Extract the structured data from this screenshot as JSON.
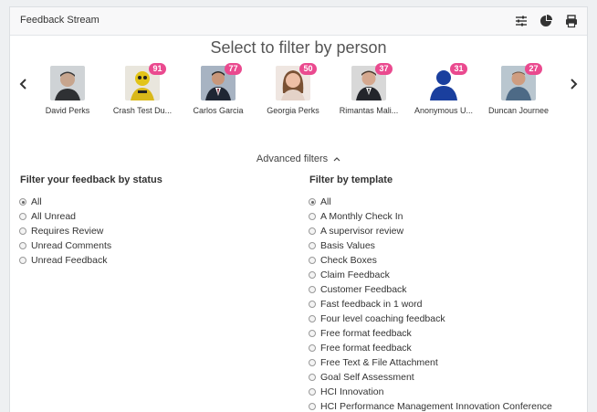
{
  "header": {
    "title": "Feedback Stream",
    "icons": [
      "filter-sliders-icon",
      "pie-chart-icon",
      "print-icon"
    ]
  },
  "people_filter": {
    "heading": "Select to filter by person",
    "people": [
      {
        "name": "David Perks",
        "badge": "",
        "avatar_icon": "photo-avatar-icon"
      },
      {
        "name": "Crash Test Du...",
        "badge": "91",
        "avatar_icon": "crash-dummy-avatar-icon"
      },
      {
        "name": "Carlos Garcia",
        "badge": "77",
        "avatar_icon": "photo-avatar-icon"
      },
      {
        "name": "Georgia Perks",
        "badge": "50",
        "avatar_icon": "photo-avatar-icon"
      },
      {
        "name": "Rimantas Mali...",
        "badge": "37",
        "avatar_icon": "photo-avatar-icon"
      },
      {
        "name": "Anonymous U...",
        "badge": "31",
        "avatar_icon": "anonymous-user-icon"
      },
      {
        "name": "Duncan Journee",
        "badge": "27",
        "avatar_icon": "photo-avatar-icon"
      }
    ]
  },
  "advanced_filters": {
    "label": "Advanced filters"
  },
  "status_filter": {
    "title": "Filter your feedback by status",
    "selected": "All",
    "options": [
      "All",
      "All Unread",
      "Requires Review",
      "Unread Comments",
      "Unread Feedback"
    ]
  },
  "template_filter": {
    "title": "Filter by template",
    "selected": "All",
    "options": [
      "All",
      "A Monthly Check In",
      "A supervisor review",
      "Basis Values",
      "Check Boxes",
      "Claim Feedback",
      "Customer Feedback",
      "Fast feedback in 1 word",
      "Four level coaching feedback",
      "Free format feedback",
      "Free format feedback",
      "Free Text & File Attachment",
      "Goal Self Assessment",
      "HCI Innovation",
      "HCI Performance Management Innovation Conference"
    ]
  },
  "colors": {
    "badge": "#ea4a8f",
    "anonymous_avatar": "#1a3f9e"
  }
}
